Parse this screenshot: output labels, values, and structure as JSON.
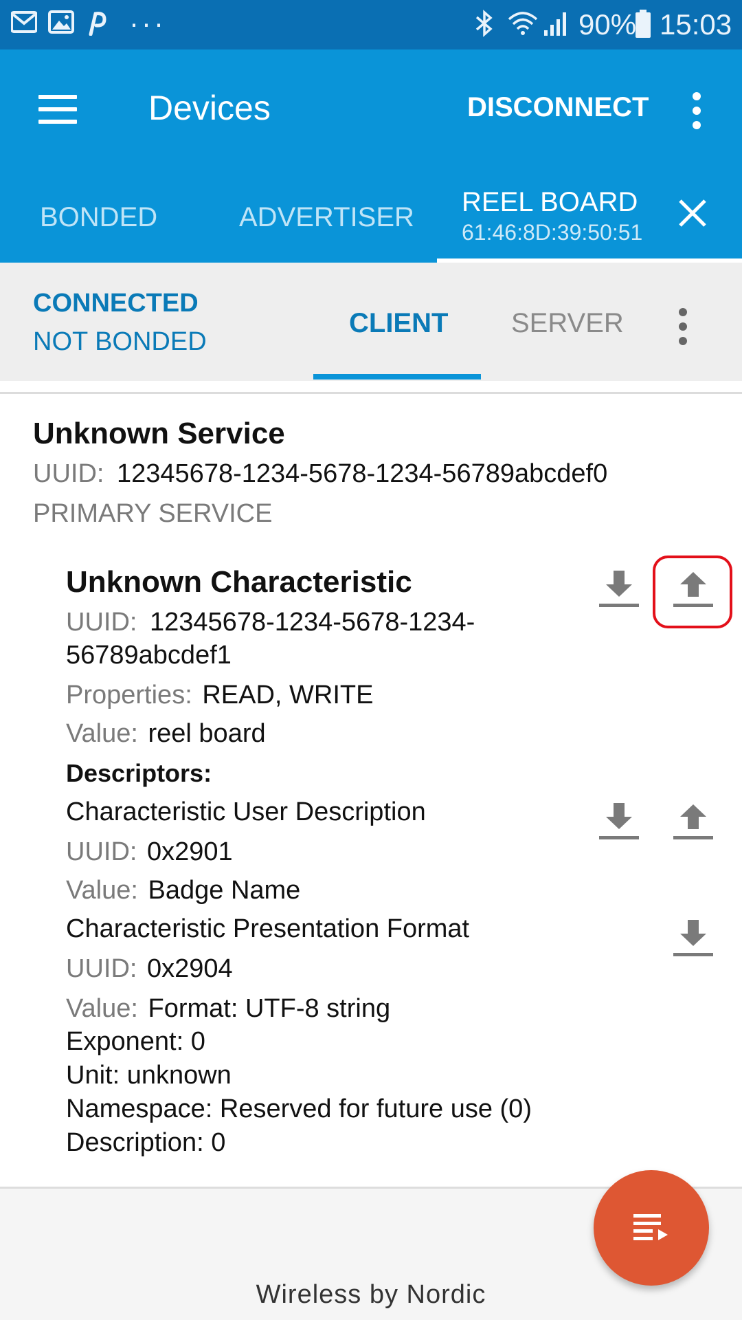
{
  "status_bar": {
    "battery": "90%",
    "time": "15:03",
    "more": "···",
    "icons": [
      "gmail-icon",
      "gallery-icon",
      "pinterest-icon",
      "bluetooth-icon",
      "wifi-icon",
      "signal-icon",
      "battery-icon"
    ]
  },
  "app_bar": {
    "title": "Devices",
    "disconnect_label": "DISCONNECT",
    "tabs": [
      {
        "label": "BONDED"
      },
      {
        "label": "ADVERTISER"
      },
      {
        "label": "REEL BOARD",
        "address": "61:46:8D:39:50:51"
      }
    ]
  },
  "sub_bar": {
    "state_connection": "CONNECTED",
    "state_bond": "NOT BONDED",
    "tab_client": "CLIENT",
    "tab_server": "SERVER"
  },
  "service": {
    "name": "Unknown Service",
    "uuid_label": "UUID:",
    "uuid": "12345678-1234-5678-1234-56789abcdef0",
    "type": "PRIMARY SERVICE"
  },
  "characteristic": {
    "name": "Unknown Characteristic",
    "uuid_label": "UUID:",
    "uuid_line1": "12345678-1234-5678-1234-",
    "uuid_line2": "56789abcdef1",
    "properties_label": "Properties:",
    "properties": "READ, WRITE",
    "value_label": "Value:",
    "value": "reel board",
    "descriptors_label": "Descriptors:"
  },
  "descriptors": [
    {
      "name": "Characteristic User Description",
      "uuid_label": "UUID:",
      "uuid": "0x2901",
      "value_label": "Value:",
      "value": "Badge Name"
    },
    {
      "name": "Characteristic Presentation Format",
      "uuid_label": "UUID:",
      "uuid": "0x2904",
      "value_label": "Value:",
      "value_lines": [
        "Format: UTF-8 string",
        "Exponent: 0",
        "Unit: unknown",
        "Namespace: Reserved for future use (0)",
        "Description: 0"
      ]
    }
  ],
  "footer": {
    "text": "Wireless by Nordic"
  },
  "colors": {
    "status_bar": "#0a6fb3",
    "app_bar": "#0a94d8",
    "accent_text": "#0a7ab7",
    "fab": "#de5733",
    "highlight": "#e3101a"
  }
}
